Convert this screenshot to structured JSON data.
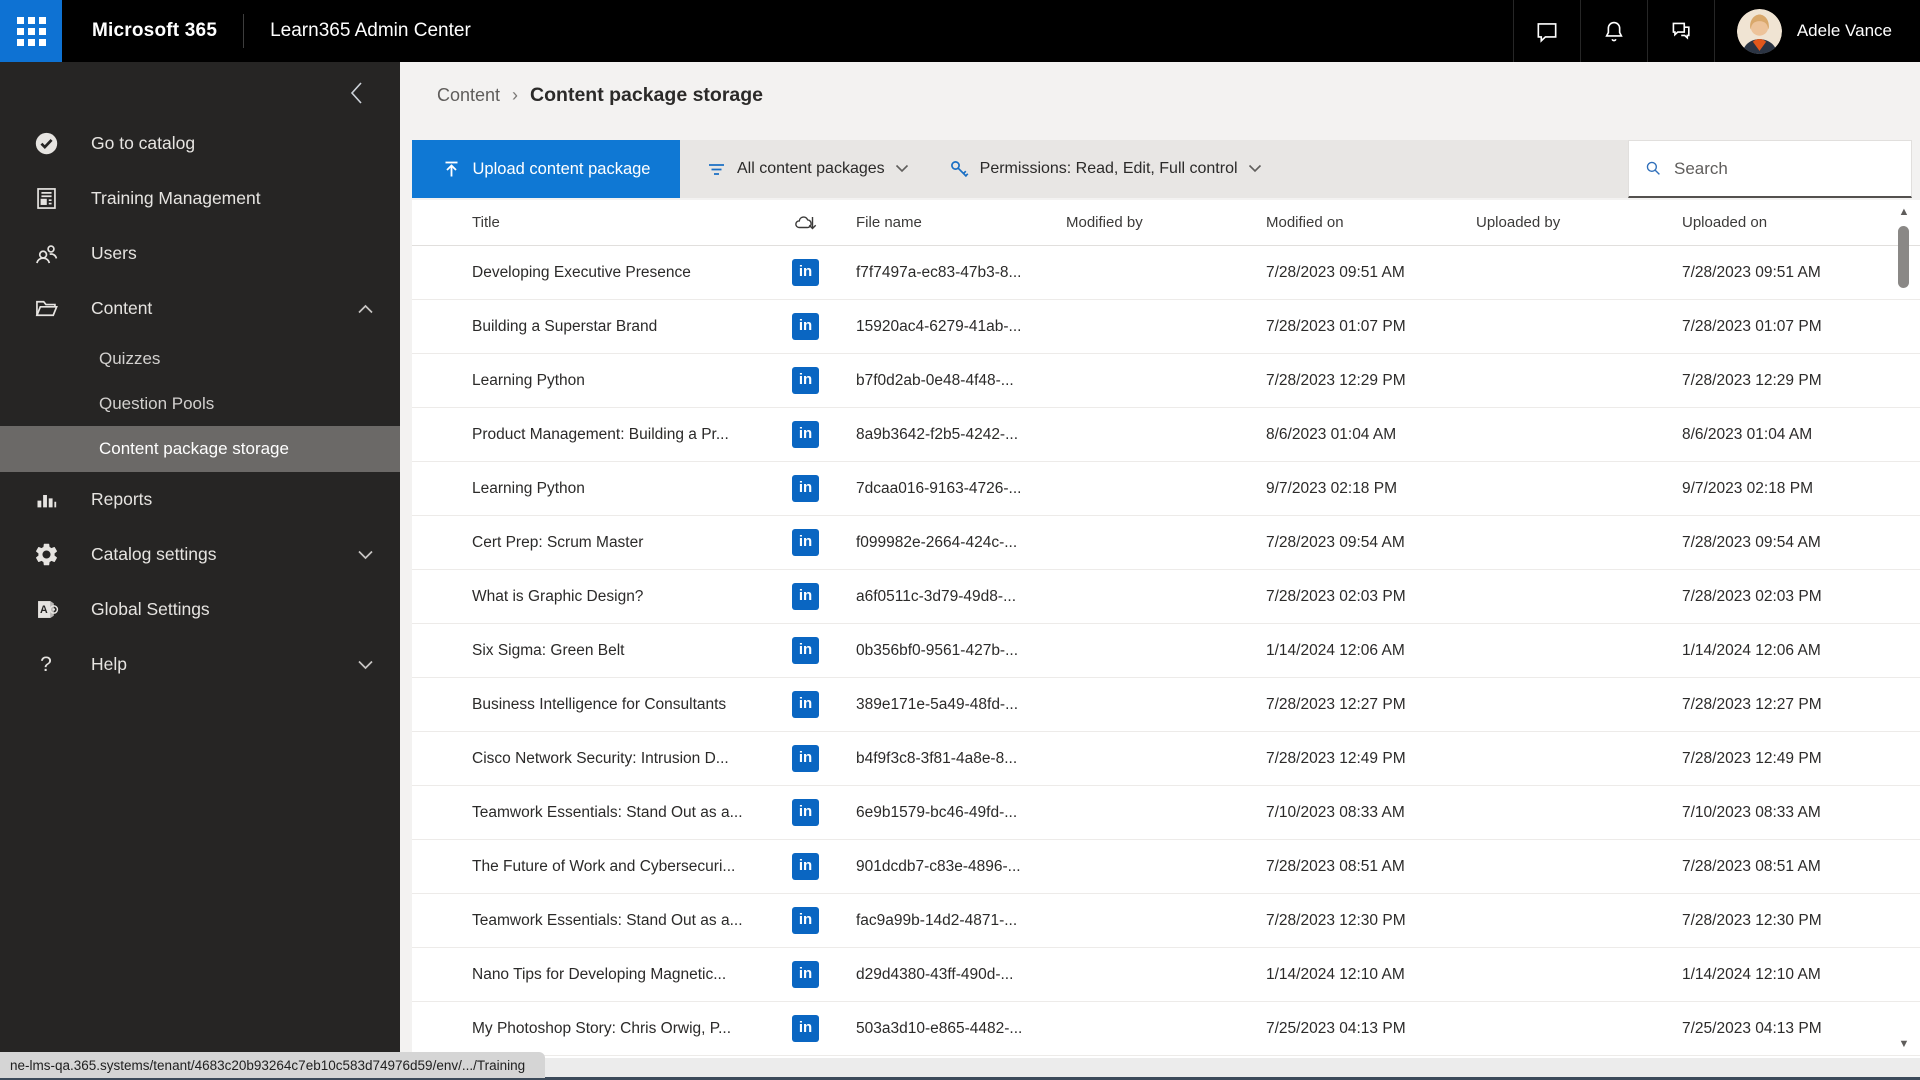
{
  "topbar": {
    "brand": "Microsoft 365",
    "app_title": "Learn365 Admin Center",
    "user_name": "Adele Vance"
  },
  "sidebar": {
    "items": [
      {
        "label": "Go to catalog"
      },
      {
        "label": "Training Management"
      },
      {
        "label": "Users"
      },
      {
        "label": "Content",
        "expanded": true,
        "children": [
          "Quizzes",
          "Question Pools",
          "Content package storage"
        ],
        "selected_child": "Content package storage"
      },
      {
        "label": "Reports"
      },
      {
        "label": "Catalog settings"
      },
      {
        "label": "Global Settings"
      },
      {
        "label": "Help"
      }
    ],
    "help_glyph": "?"
  },
  "breadcrumb": {
    "parent": "Content",
    "separator": "›",
    "current": "Content package storage"
  },
  "toolbar": {
    "upload_label": "Upload content package",
    "filter_label": "All content packages",
    "permissions_label": "Permissions: Read, Edit, Full control",
    "search_placeholder": "Search"
  },
  "table": {
    "linkedin_glyph": "in",
    "header": {
      "title": "Title",
      "file_name": "File name",
      "modified_by": "Modified by",
      "modified_on": "Modified on",
      "uploaded_by": "Uploaded by",
      "uploaded_on": "Uploaded on"
    },
    "rows": [
      {
        "title": "Developing Executive Presence",
        "file_name": "f7f7497a-ec83-47b3-8...",
        "modified_by": "",
        "modified_on": "7/28/2023 09:51 AM",
        "uploaded_by": "",
        "uploaded_on": "7/28/2023 09:51 AM"
      },
      {
        "title": "Building a Superstar Brand",
        "file_name": "15920ac4-6279-41ab-...",
        "modified_by": "",
        "modified_on": "7/28/2023 01:07 PM",
        "uploaded_by": "",
        "uploaded_on": "7/28/2023 01:07 PM"
      },
      {
        "title": "Learning Python",
        "file_name": "b7f0d2ab-0e48-4f48-...",
        "modified_by": "",
        "modified_on": "7/28/2023 12:29 PM",
        "uploaded_by": "",
        "uploaded_on": "7/28/2023 12:29 PM"
      },
      {
        "title": "Product Management: Building a Pr...",
        "file_name": "8a9b3642-f2b5-4242-...",
        "modified_by": "",
        "modified_on": "8/6/2023 01:04 AM",
        "uploaded_by": "",
        "uploaded_on": "8/6/2023 01:04 AM"
      },
      {
        "title": "Learning Python",
        "file_name": "7dcaa016-9163-4726-...",
        "modified_by": "",
        "modified_on": "9/7/2023 02:18 PM",
        "uploaded_by": "",
        "uploaded_on": "9/7/2023 02:18 PM"
      },
      {
        "title": "Cert Prep: Scrum Master",
        "file_name": "f099982e-2664-424c-...",
        "modified_by": "",
        "modified_on": "7/28/2023 09:54 AM",
        "uploaded_by": "",
        "uploaded_on": "7/28/2023 09:54 AM"
      },
      {
        "title": "What is Graphic Design?",
        "file_name": "a6f0511c-3d79-49d8-...",
        "modified_by": "",
        "modified_on": "7/28/2023 02:03 PM",
        "uploaded_by": "",
        "uploaded_on": "7/28/2023 02:03 PM"
      },
      {
        "title": "Six Sigma: Green Belt",
        "file_name": "0b356bf0-9561-427b-...",
        "modified_by": "",
        "modified_on": "1/14/2024 12:06 AM",
        "uploaded_by": "",
        "uploaded_on": "1/14/2024 12:06 AM"
      },
      {
        "title": "Business Intelligence for Consultants",
        "file_name": "389e171e-5a49-48fd-...",
        "modified_by": "",
        "modified_on": "7/28/2023 12:27 PM",
        "uploaded_by": "",
        "uploaded_on": "7/28/2023 12:27 PM"
      },
      {
        "title": "Cisco Network Security: Intrusion D...",
        "file_name": "b4f9f3c8-3f81-4a8e-8...",
        "modified_by": "",
        "modified_on": "7/28/2023 12:49 PM",
        "uploaded_by": "",
        "uploaded_on": "7/28/2023 12:49 PM"
      },
      {
        "title": "Teamwork Essentials: Stand Out as a...",
        "file_name": "6e9b1579-bc46-49fd-...",
        "modified_by": "",
        "modified_on": "7/10/2023 08:33 AM",
        "uploaded_by": "",
        "uploaded_on": "7/10/2023 08:33 AM"
      },
      {
        "title": "The Future of Work and Cybersecuri...",
        "file_name": "901dcdb7-c83e-4896-...",
        "modified_by": "",
        "modified_on": "7/28/2023 08:51 AM",
        "uploaded_by": "",
        "uploaded_on": "7/28/2023 08:51 AM"
      },
      {
        "title": "Teamwork Essentials: Stand Out as a...",
        "file_name": "fac9a99b-14d2-4871-...",
        "modified_by": "",
        "modified_on": "7/28/2023 12:30 PM",
        "uploaded_by": "",
        "uploaded_on": "7/28/2023 12:30 PM"
      },
      {
        "title": "Nano Tips for Developing Magnetic...",
        "file_name": "d29d4380-43ff-490d-...",
        "modified_by": "",
        "modified_on": "1/14/2024 12:10 AM",
        "uploaded_by": "",
        "uploaded_on": "1/14/2024 12:10 AM"
      },
      {
        "title": "My Photoshop Story: Chris Orwig, P...",
        "file_name": "503a3d10-e865-4482-...",
        "modified_by": "",
        "modified_on": "7/25/2023 04:13 PM",
        "uploaded_by": "",
        "uploaded_on": "7/25/2023 04:13 PM"
      }
    ]
  },
  "statusbar": {
    "url": "ne-lms-qa.365.systems/tenant/4683c20b93264c7eb10c583d74976d59/env/.../Training"
  },
  "colors": {
    "topbar_bg": "#000000",
    "waffle_blue": "#0e72d3",
    "sidebar_bg": "#262524",
    "selected_nav_bg": "#6b6967",
    "accent_blue": "#0f78d4",
    "linkedin_blue": "#0a66c2",
    "toolbar_bg": "#e8e6e4",
    "main_bg": "#f3f2f1"
  }
}
